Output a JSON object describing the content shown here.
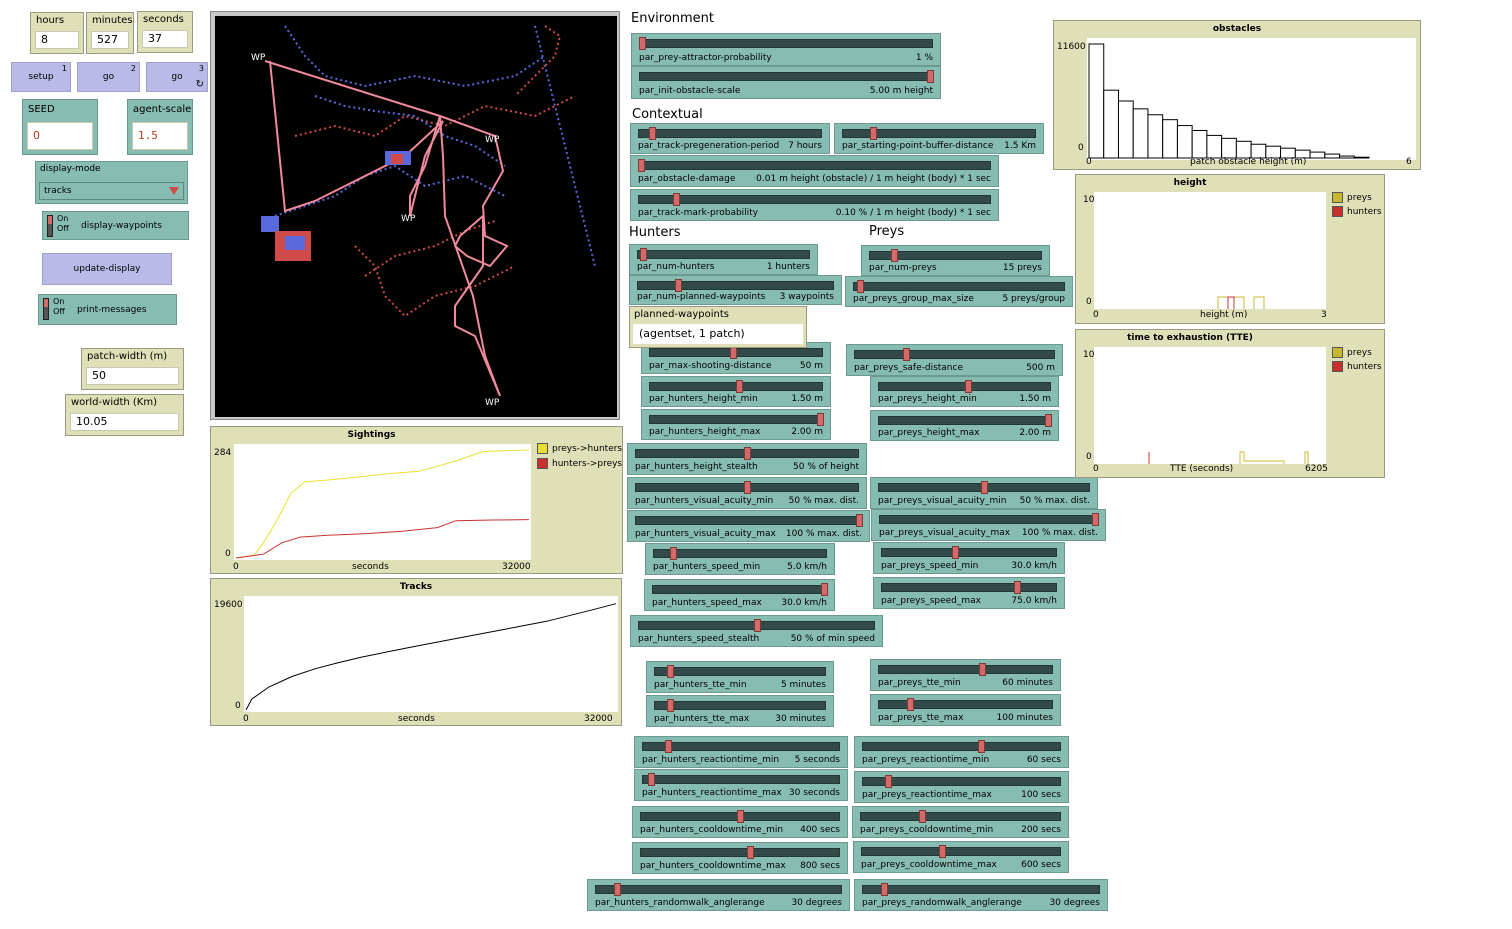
{
  "monitors": {
    "hours": {
      "label": "hours",
      "value": "8"
    },
    "minutes": {
      "label": "minutes",
      "value": "527"
    },
    "seconds": {
      "label": "seconds",
      "value": "37"
    },
    "patch_width": {
      "label": "patch-width (m)",
      "value": "50"
    },
    "world_width": {
      "label": "world-width (Km)",
      "value": "10.05"
    }
  },
  "buttons": {
    "setup": {
      "label": "setup",
      "key": "1"
    },
    "go_once": {
      "label": "go",
      "key": "2"
    },
    "go_forever": {
      "label": "go",
      "key": "3",
      "forever": "↻"
    },
    "update_display": {
      "label": "update-display"
    }
  },
  "inputs": {
    "seed": {
      "label": "SEED",
      "value": "0"
    },
    "agent_scale": {
      "label": "agent-scale",
      "value": "1.5"
    }
  },
  "chooser": {
    "label": "display-mode",
    "value": "tracks"
  },
  "toggles": {
    "on": "On",
    "off": "Off",
    "display_waypoints": "display-waypoints",
    "print_messages": "print-messages"
  },
  "view": {
    "wp_label": "WP"
  },
  "sections": {
    "environment": "Environment",
    "contextual": "Contextual",
    "hunters": "Hunters",
    "preys": "Preys"
  },
  "output": {
    "label": "planned-waypoints",
    "value": "(agentset, 1 patch)"
  },
  "sliders": [
    {
      "id": "prey-attractor",
      "name": "par_prey-attractor-probability",
      "value": "1 %",
      "pos": 0
    },
    {
      "id": "init-obstacle-scale",
      "name": "par_init-obstacle-scale",
      "value": "5.00 m height",
      "pos": 1
    },
    {
      "id": "track-pregeneration",
      "name": "par_track-pregeneration-period",
      "value": "7 hours",
      "pos": 0.06
    },
    {
      "id": "starting-point-buffer",
      "name": "par_starting-point-buffer-distance",
      "value": "1.5 Km",
      "pos": 0.15
    },
    {
      "id": "obstacle-damage",
      "name": "par_obstacle-damage",
      "value": "0.01 m height (obstacle) / 1 m height (body) * 1 sec",
      "pos": 0
    },
    {
      "id": "track-mark-probability",
      "name": "par_track-mark-probability",
      "value": "0.10 % / 1 m height (body) * 1 sec",
      "pos": 0.1
    },
    {
      "id": "num-hunters",
      "name": "par_num-hunters",
      "value": "1 hunters",
      "pos": 0.02
    },
    {
      "id": "num-planned-waypoints",
      "name": "par_num-planned-waypoints",
      "value": "3 waypoints",
      "pos": 0.2
    },
    {
      "id": "num-preys",
      "name": "par_num-preys",
      "value": "15 preys",
      "pos": 0.13
    },
    {
      "id": "preys-group-max-size",
      "name": "par_preys_group_max_size",
      "value": "5 preys/group",
      "pos": 0.02
    },
    {
      "id": "max-shooting-distance",
      "name": "par_max-shooting-distance",
      "value": "50 m",
      "pos": 0.48
    },
    {
      "id": "preys-safe-distance",
      "name": "par_preys_safe-distance",
      "value": "500 m",
      "pos": 0.25
    },
    {
      "id": "hunters-height-min",
      "name": "par_hunters_height_min",
      "value": "1.50 m",
      "pos": 0.52
    },
    {
      "id": "preys-height-min",
      "name": "par_preys_height_min",
      "value": "1.50 m",
      "pos": 0.52
    },
    {
      "id": "hunters-height-max",
      "name": "par_hunters_height_max",
      "value": "2.00 m",
      "pos": 1
    },
    {
      "id": "preys-height-max",
      "name": "par_preys_height_max",
      "value": "2.00 m",
      "pos": 1
    },
    {
      "id": "hunters-height-stealth",
      "name": "par_hunters_height_stealth",
      "value": "50 % of height",
      "pos": 0.5
    },
    {
      "id": "hunters-visual-acuity-min",
      "name": "par_hunters_visual_acuity_min",
      "value": "50 % max. dist.",
      "pos": 0.5
    },
    {
      "id": "preys-visual-acuity-min",
      "name": "par_preys_visual_acuity_min",
      "value": "50 % max. dist.",
      "pos": 0.5
    },
    {
      "id": "hunters-visual-acuity-max",
      "name": "par_hunters_visual_acuity_max",
      "value": "100 % max. dist.",
      "pos": 1
    },
    {
      "id": "preys-visual-acuity-max",
      "name": "par_preys_visual_acuity_max",
      "value": "100 % max. dist.",
      "pos": 1
    },
    {
      "id": "hunters-speed-min",
      "name": "par_hunters_speed_min",
      "value": "5.0 km/h",
      "pos": 0.1
    },
    {
      "id": "preys-speed-min",
      "name": "par_preys_speed_min",
      "value": "30.0 km/h",
      "pos": 0.42
    },
    {
      "id": "hunters-speed-max",
      "name": "par_hunters_speed_max",
      "value": "30.0 km/h",
      "pos": 1
    },
    {
      "id": "preys-speed-max",
      "name": "par_preys_speed_max",
      "value": "75.0 km/h",
      "pos": 0.78
    },
    {
      "id": "hunters-speed-stealth",
      "name": "par_hunters_speed_stealth",
      "value": "50 % of min speed",
      "pos": 0.5
    },
    {
      "id": "hunters-tte-min",
      "name": "par_hunters_tte_min",
      "value": "5 minutes",
      "pos": 0.08
    },
    {
      "id": "preys-tte-min",
      "name": "par_preys_tte_min",
      "value": "60 minutes",
      "pos": 0.6
    },
    {
      "id": "hunters-tte-max",
      "name": "par_hunters_tte_max",
      "value": "30 minutes",
      "pos": 0.08
    },
    {
      "id": "preys-tte-max",
      "name": "par_preys_tte_max",
      "value": "100 minutes",
      "pos": 0.17
    },
    {
      "id": "hunters-reactiontime-min",
      "name": "par_hunters_reactiontime_min",
      "value": "5 seconds",
      "pos": 0.12
    },
    {
      "id": "preys-reactiontime-min",
      "name": "par_preys_reactiontime_min",
      "value": "60 secs",
      "pos": 0.6
    },
    {
      "id": "hunters-reactiontime-max",
      "name": "par_hunters_reactiontime_max",
      "value": "30 seconds",
      "pos": 0.03
    },
    {
      "id": "preys-reactiontime-max",
      "name": "par_preys_reactiontime_max",
      "value": "100 secs",
      "pos": 0.12
    },
    {
      "id": "hunters-cooldowntime-min",
      "name": "par_hunters_cooldowntime_min",
      "value": "400 secs",
      "pos": 0.5
    },
    {
      "id": "preys-cooldowntime-min",
      "name": "par_preys_cooldowntime_min",
      "value": "200 secs",
      "pos": 0.3
    },
    {
      "id": "hunters-cooldowntime-max",
      "name": "par_hunters_cooldowntime_max",
      "value": "800 secs",
      "pos": 0.55
    },
    {
      "id": "preys-cooldowntime-max",
      "name": "par_preys_cooldowntime_max",
      "value": "600 secs",
      "pos": 0.4
    },
    {
      "id": "hunters-randomwalk",
      "name": "par_hunters_randomwalk_anglerange",
      "value": "30 degrees",
      "pos": 0.08
    },
    {
      "id": "preys-randomwalk",
      "name": "par_preys_randomwalk_anglerange",
      "value": "30 degrees",
      "pos": 0.08
    }
  ],
  "plots": {
    "obstacles": {
      "title": "obstacles",
      "xlabel": "patch obstacle height (m)",
      "xmin": "0",
      "xmax": "6",
      "ymin": "0",
      "ymax": "11600"
    },
    "height": {
      "title": "height",
      "xlabel": "height (m)",
      "xmin": "0",
      "xmax": "3",
      "ymin": "0",
      "ymax": "10",
      "legend": [
        "preys",
        "hunters"
      ]
    },
    "tte": {
      "title": "time to exhaustion (TTE)",
      "xlabel": "TTE (seconds)",
      "xmin": "0",
      "xmax": "6205",
      "ymin": "0",
      "ymax": "10",
      "legend": [
        "preys",
        "hunters"
      ]
    },
    "sightings": {
      "title": "Sightings",
      "xlabel": "seconds",
      "xmin": "0",
      "xmax": "32000",
      "ymin": "0",
      "ymax": "284",
      "legend": [
        "preys->hunters",
        "hunters->preys"
      ]
    },
    "tracks": {
      "title": "Tracks",
      "xlabel": "seconds",
      "xmin": "0",
      "xmax": "32000",
      "ymin": "0",
      "ymax": "19600"
    }
  },
  "chart_data": [
    {
      "type": "bar",
      "title": "obstacles",
      "xlabel": "patch obstacle height (m)",
      "xlim": [
        0,
        6
      ],
      "ylim": [
        0,
        11600
      ],
      "values": [
        11600,
        6900,
        5800,
        5000,
        4400,
        3900,
        3300,
        2800,
        2300,
        2000,
        1700,
        1400,
        1200,
        1000,
        800,
        600,
        400,
        200,
        80
      ]
    },
    {
      "type": "line",
      "title": "Sightings",
      "xlabel": "seconds",
      "xlim": [
        0,
        32000
      ],
      "ylim": [
        0,
        284
      ],
      "series": [
        {
          "name": "preys->hunters",
          "color": "#e8e030",
          "x": [
            0,
            2000,
            3000,
            4500,
            6000,
            7500,
            10000,
            13000,
            16000,
            20000,
            24000,
            27000,
            32000
          ],
          "y": [
            0,
            8,
            40,
            100,
            170,
            200,
            205,
            212,
            220,
            228,
            255,
            280,
            284
          ]
        },
        {
          "name": "hunters->preys",
          "color": "#c83030",
          "x": [
            0,
            3000,
            5000,
            7000,
            10000,
            14000,
            18000,
            22000,
            24000,
            28000,
            32000
          ],
          "y": [
            0,
            10,
            40,
            55,
            60,
            64,
            70,
            80,
            98,
            100,
            101
          ]
        }
      ]
    },
    {
      "type": "line",
      "title": "Tracks",
      "xlabel": "seconds",
      "xlim": [
        0,
        32000
      ],
      "ylim": [
        0,
        19600
      ],
      "series": [
        {
          "name": "",
          "color": "#000000",
          "x": [
            0,
            500,
            2000,
            4000,
            6000,
            8000,
            10000,
            14000,
            18000,
            22000,
            26000,
            30000,
            32000
          ],
          "y": [
            0,
            2000,
            4200,
            6100,
            7500,
            8600,
            9600,
            11300,
            12900,
            14500,
            16100,
            18200,
            19300
          ]
        }
      ]
    }
  ],
  "colors": {
    "slider": "#86bcb1",
    "monitor": "#e0e0b8",
    "button": "#babae8",
    "preys": "#c8b830",
    "hunters": "#c83030"
  }
}
